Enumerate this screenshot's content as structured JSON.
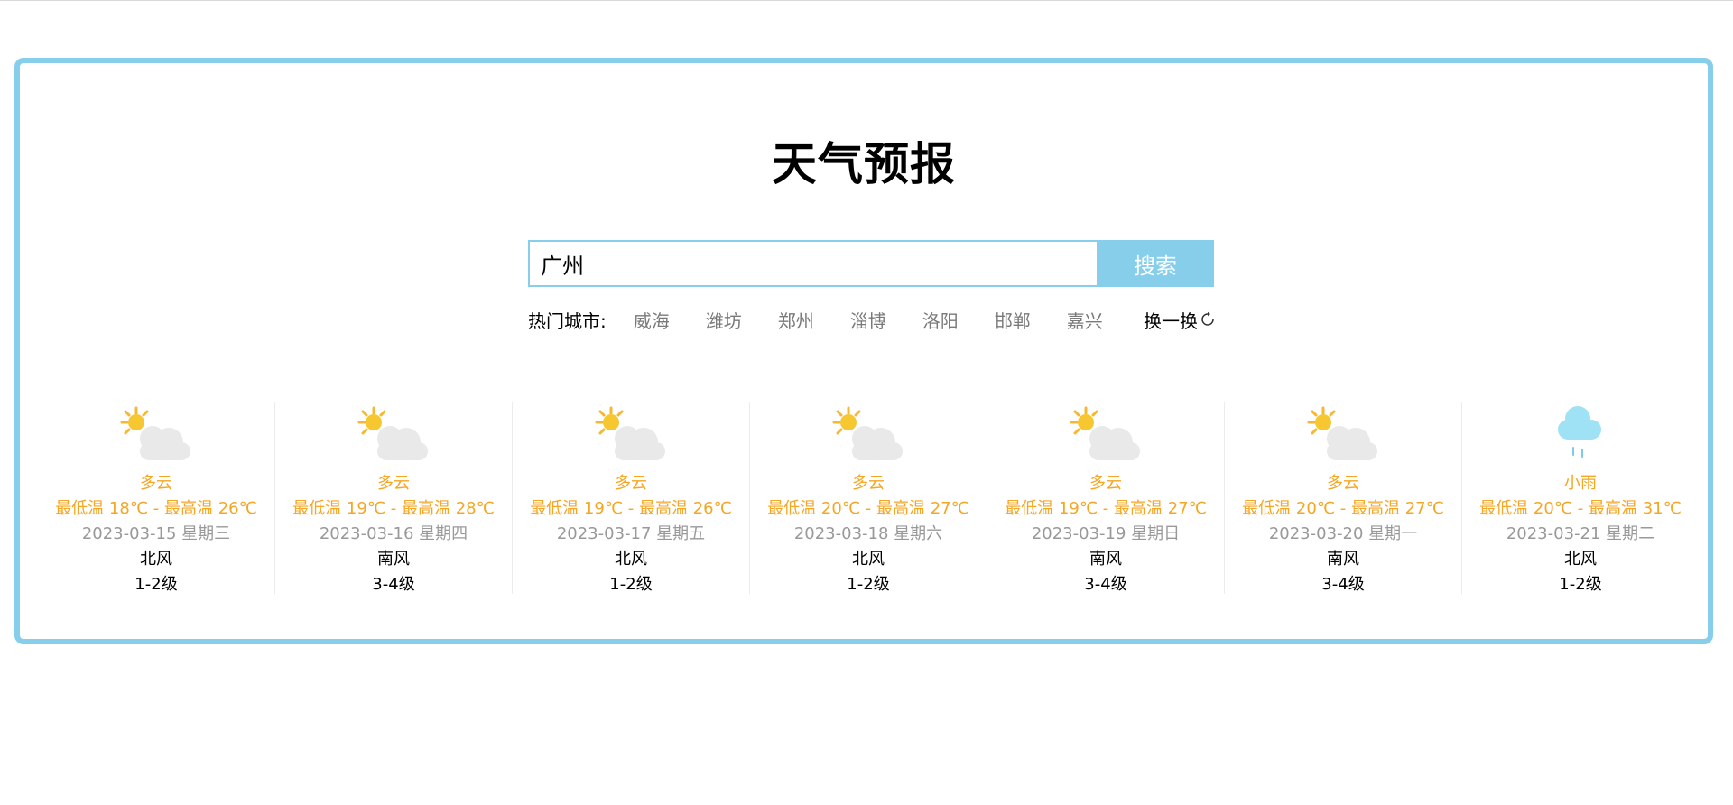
{
  "title": "天气预报",
  "search": {
    "value": "广州",
    "placeholder": "",
    "button_label": "搜索"
  },
  "hot_cities": {
    "label": "热门城市:",
    "cities": [
      "威海",
      "潍坊",
      "郑州",
      "淄博",
      "洛阳",
      "邯郸",
      "嘉兴"
    ],
    "refresh_label": "换一换"
  },
  "colors": {
    "accent": "#87ceeb",
    "warm_text": "#f5a623",
    "muted_text": "#999999"
  },
  "forecast": [
    {
      "icon": "partly-cloudy-icon",
      "condition": "多云",
      "temp": "最低温 18℃ - 最高温 26℃",
      "date": "2023-03-15 星期三",
      "wind": "北风",
      "level": "1-2级"
    },
    {
      "icon": "partly-cloudy-icon",
      "condition": "多云",
      "temp": "最低温 19℃ - 最高温 28℃",
      "date": "2023-03-16 星期四",
      "wind": "南风",
      "level": "3-4级"
    },
    {
      "icon": "partly-cloudy-icon",
      "condition": "多云",
      "temp": "最低温 19℃ - 最高温 26℃",
      "date": "2023-03-17 星期五",
      "wind": "北风",
      "level": "1-2级"
    },
    {
      "icon": "partly-cloudy-icon",
      "condition": "多云",
      "temp": "最低温 20℃ - 最高温 27℃",
      "date": "2023-03-18 星期六",
      "wind": "北风",
      "level": "1-2级"
    },
    {
      "icon": "partly-cloudy-icon",
      "condition": "多云",
      "temp": "最低温 19℃ - 最高温 27℃",
      "date": "2023-03-19 星期日",
      "wind": "南风",
      "level": "3-4级"
    },
    {
      "icon": "partly-cloudy-icon",
      "condition": "多云",
      "temp": "最低温 20℃ - 最高温 27℃",
      "date": "2023-03-20 星期一",
      "wind": "南风",
      "level": "3-4级"
    },
    {
      "icon": "light-rain-icon",
      "condition": "小雨",
      "temp": "最低温 20℃ - 最高温 31℃",
      "date": "2023-03-21 星期二",
      "wind": "北风",
      "level": "1-2级"
    }
  ]
}
